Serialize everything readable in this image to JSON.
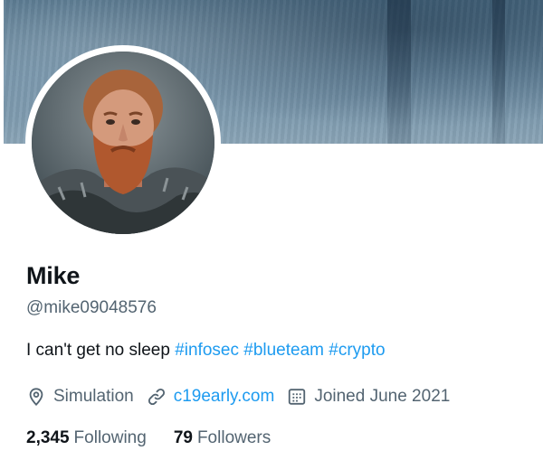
{
  "profile": {
    "name": "Mike",
    "handle": "@mike09048576",
    "bio_text": "I can't get no sleep",
    "bio_hashtags": [
      "#infosec",
      "#blueteam",
      "#crypto"
    ],
    "location": "Simulation",
    "website": "c19early.com",
    "joined": "Joined June 2021"
  },
  "stats": {
    "following_count": "2,345",
    "following_label": "Following",
    "followers_count": "79",
    "followers_label": "Followers"
  },
  "icons": {
    "location": "location-pin-icon",
    "website": "link-icon",
    "joined": "calendar-icon"
  },
  "colors": {
    "accent": "#1d9bf0",
    "secondary_text": "#536471",
    "primary_text": "#0f1419"
  }
}
